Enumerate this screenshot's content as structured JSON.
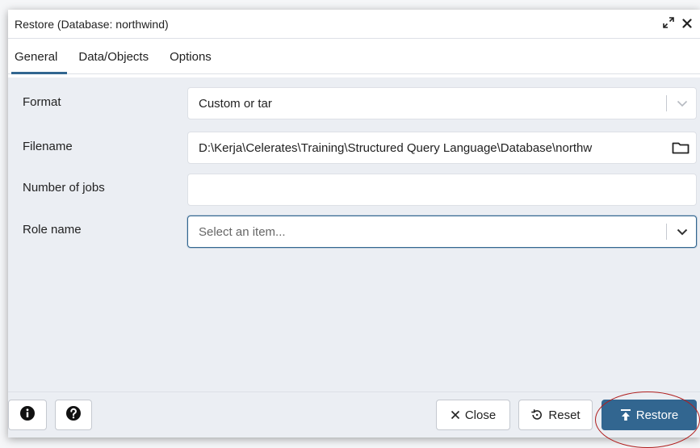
{
  "dialog": {
    "title": "Restore (Database: northwind)",
    "expand_icon": "expand-icon",
    "close_icon": "close-icon"
  },
  "tabs": [
    {
      "label": "General",
      "active": true
    },
    {
      "label": "Data/Objects",
      "active": false
    },
    {
      "label": "Options",
      "active": false
    }
  ],
  "form": {
    "format": {
      "label": "Format",
      "value": "Custom or tar"
    },
    "filename": {
      "label": "Filename",
      "value": "D:\\Kerja\\Celerates\\Training\\Structured Query Language\\Database\\northw"
    },
    "jobs": {
      "label": "Number of jobs",
      "value": ""
    },
    "role": {
      "label": "Role name",
      "placeholder": "Select an item..."
    }
  },
  "footer": {
    "info_icon": "info-icon",
    "help_icon": "help-icon",
    "close_label": "Close",
    "reset_label": "Reset",
    "restore_label": "Restore"
  },
  "colors": {
    "primary": "#326690",
    "panel_bg": "#ebeef3",
    "annotation": "#b01e1e"
  }
}
